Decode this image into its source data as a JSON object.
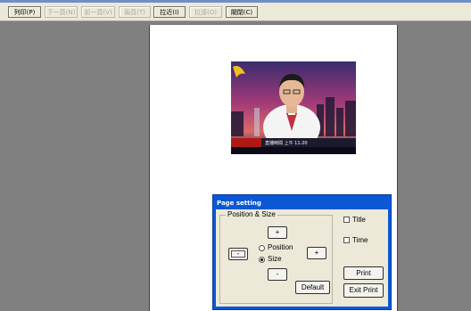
{
  "toolbar": {
    "buttons": [
      {
        "label": "列印(P)",
        "enabled": true
      },
      {
        "label": "下一頁(N)",
        "enabled": false
      },
      {
        "label": "前一頁(V)",
        "enabled": false
      },
      {
        "label": "兩頁(T)",
        "enabled": false
      },
      {
        "label": "拉近(I)",
        "enabled": true
      },
      {
        "label": "拉遠(O)",
        "enabled": false
      },
      {
        "label": "關閉(C)",
        "enabled": true
      }
    ]
  },
  "dialog": {
    "title": "Page setting",
    "group_label": "Position & Size",
    "up_button": "+",
    "down_button": "-",
    "left_button": "-",
    "right_button": "+",
    "radio_position": "Position",
    "radio_size": "Size",
    "selected_mode": "Size",
    "default_button": "Default",
    "title_checkbox": "Title",
    "time_checkbox": "Time",
    "print_button": "Print",
    "exit_button": "Exit Print"
  },
  "photo": {
    "caption_strip": "直播時間 上午 11:20"
  },
  "colors": {
    "toolbar_bg": "#ece9d8",
    "workspace_bg": "#808080",
    "dialog_title_bg": "#0a58d6"
  }
}
